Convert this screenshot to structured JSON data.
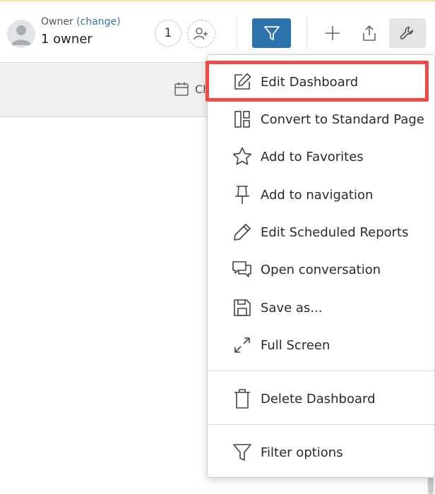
{
  "owner": {
    "label": "Owner",
    "change_link": "(change)",
    "count_text": "1 owner"
  },
  "toolbar": {
    "owner_count_badge": "1",
    "icons": [
      "user-avatar-icon",
      "add-user-icon",
      "filter-icon",
      "plus-icon",
      "share-icon",
      "wrench-icon"
    ],
    "filter_button_color": "#2c73ae"
  },
  "subbar": {
    "label": "Ch",
    "icon": "calendar-icon"
  },
  "menu": {
    "items": [
      {
        "label": "Edit Dashboard",
        "icon": "edit-icon"
      },
      {
        "label": "Convert to Standard Page",
        "icon": "layout-icon"
      },
      {
        "label": "Add to Favorites",
        "icon": "star-icon"
      },
      {
        "label": "Add to navigation",
        "icon": "pin-icon"
      },
      {
        "label": "Edit Scheduled Reports",
        "icon": "pencil-icon"
      },
      {
        "label": "Open conversation",
        "icon": "chat-icon"
      },
      {
        "label": "Save as...",
        "icon": "save-icon"
      },
      {
        "label": "Full Screen",
        "icon": "fullscreen-icon"
      },
      {
        "label": "Delete Dashboard",
        "icon": "trash-icon"
      },
      {
        "label": "Filter options",
        "icon": "filter-icon"
      }
    ],
    "highlight_color": "#ef4a43"
  }
}
